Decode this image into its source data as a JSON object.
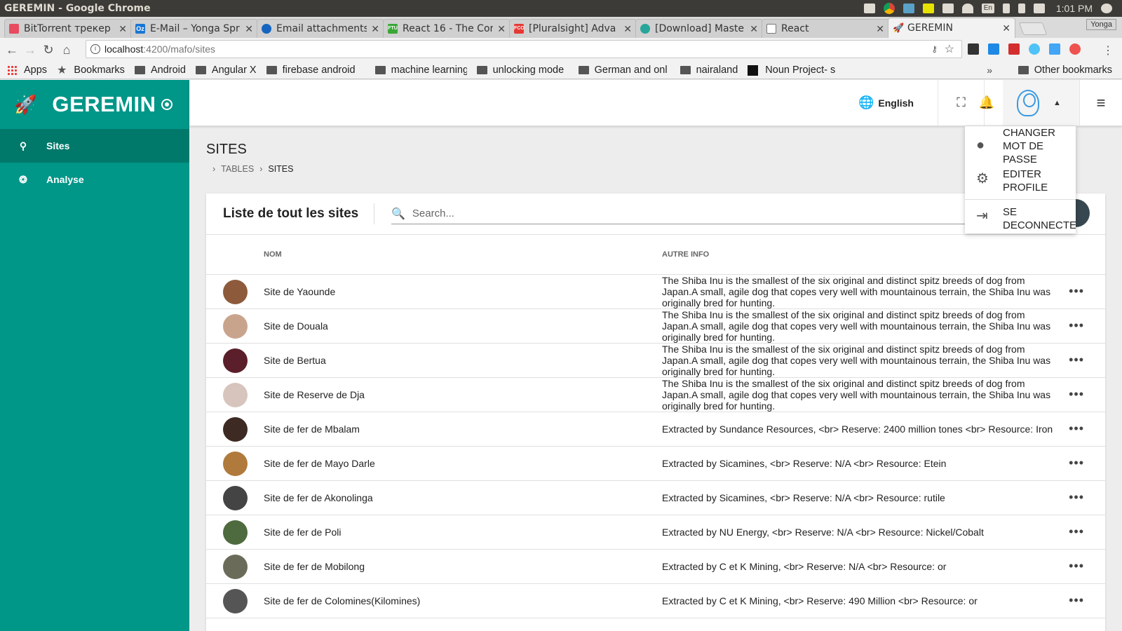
{
  "os": {
    "title": "GEREMIN - Google Chrome",
    "keyboard": "En",
    "time": "1:01 PM"
  },
  "tabs": [
    {
      "label": "BitTorrent трекер",
      "fav_color": "#e84a5f"
    },
    {
      "label": "E-Mail – Yonga Spr",
      "fav_color": "#1976d2",
      "fav_text": "Oz"
    },
    {
      "label": "Email attachments",
      "fav_color": "#1565c0"
    },
    {
      "label": "React 16 - The Com",
      "fav_color": "#3aa635",
      "fav_text": "FTU"
    },
    {
      "label": "[Pluralsight] Adva",
      "fav_color": "#e53935",
      "fav_text": "FCO"
    },
    {
      "label": "[Download] Maste",
      "fav_color": "#26a69a"
    },
    {
      "label": "React",
      "fav_color": "#9e9e9e"
    },
    {
      "label": "GEREMIN",
      "fav_color": "#333333"
    }
  ],
  "profile_name": "Yonga",
  "address": {
    "host": "localhost",
    "path": ":4200/mafo/sites"
  },
  "bookmarks": {
    "apps": "Apps",
    "bookmarks": "Bookmarks",
    "folders": [
      "Android",
      "Angular X",
      "firebase android",
      "machine learning",
      "unlocking mode",
      "German and onl",
      "nairaland"
    ],
    "noun": "Noun Project- s",
    "other": "Other bookmarks"
  },
  "sidebar": {
    "brand": "GEREMIN",
    "items": [
      {
        "label": "Sites",
        "icon": "map-pin-icon"
      },
      {
        "label": "Analyse",
        "icon": "chart-icon"
      }
    ]
  },
  "header": {
    "language": "English"
  },
  "page": {
    "title": "SITES",
    "breadcrumb": [
      "TABLES",
      "SITES"
    ]
  },
  "card": {
    "title": "Liste de tout les sites",
    "search_placeholder": "Search...",
    "columns": {
      "nom": "NOM",
      "info": "AUTRE INFO"
    },
    "rows": [
      {
        "name": "Site de Yaounde",
        "info": "The Shiba Inu is the smallest of the six original and distinct spitz breeds of dog from Japan.A small, agile dog that copes very well with mountainous terrain, the Shiba Inu was originally bred for hunting.",
        "avatar": "#8d5a3b"
      },
      {
        "name": "Site de Douala",
        "info": "The Shiba Inu is the smallest of the six original and distinct spitz breeds of dog from Japan.A small, agile dog that copes very well with mountainous terrain, the Shiba Inu was originally bred for hunting.",
        "avatar": "#c9a48c"
      },
      {
        "name": "Site de Bertua",
        "info": "The Shiba Inu is the smallest of the six original and distinct spitz breeds of dog from Japan.A small, agile dog that copes very well with mountainous terrain, the Shiba Inu was originally bred for hunting.",
        "avatar": "#5a1f2a"
      },
      {
        "name": "Site de Reserve de Dja",
        "info": "The Shiba Inu is the smallest of the six original and distinct spitz breeds of dog from Japan.A small, agile dog that copes very well with mountainous terrain, the Shiba Inu was originally bred for hunting.",
        "avatar": "#d7c4bd"
      },
      {
        "name": "Site de fer de Mbalam",
        "info": "Extracted by Sundance Resources, <br> Reserve: 2400 million tones <br> Resource: Iron",
        "avatar": "#3d2a22"
      },
      {
        "name": "Site de fer de Mayo Darle",
        "info": "Extracted by Sicamines, <br> Reserve: N/A <br> Resource: Etein",
        "avatar": "#b07a3c"
      },
      {
        "name": "Site de fer de Akonolinga",
        "info": "Extracted by Sicamines, <br> Reserve: N/A <br> Resource: rutile",
        "avatar": "#444444"
      },
      {
        "name": "Site de fer de Poli",
        "info": "Extracted by NU Energy, <br> Reserve: N/A <br> Resource: Nickel/Cobalt",
        "avatar": "#4e6b3f"
      },
      {
        "name": "Site de fer de Mobilong",
        "info": "Extracted by C et K Mining, <br> Reserve: N/A <br> Resource: or",
        "avatar": "#6b6b5a"
      },
      {
        "name": "Site de fer de Colomines(Kilomines)",
        "info": "Extracted by C et K Mining, <br> Reserve: 490 Million <br> Resource: or",
        "avatar": "#555555"
      }
    ]
  },
  "dropdown": [
    {
      "label": "CHANGER MOT DE PASSE",
      "icon": "account-circle-icon"
    },
    {
      "label": "EDITER PROFILE",
      "icon": "gear-icon"
    },
    {
      "label": "SE DECONNECTER",
      "icon": "logout-icon"
    }
  ]
}
